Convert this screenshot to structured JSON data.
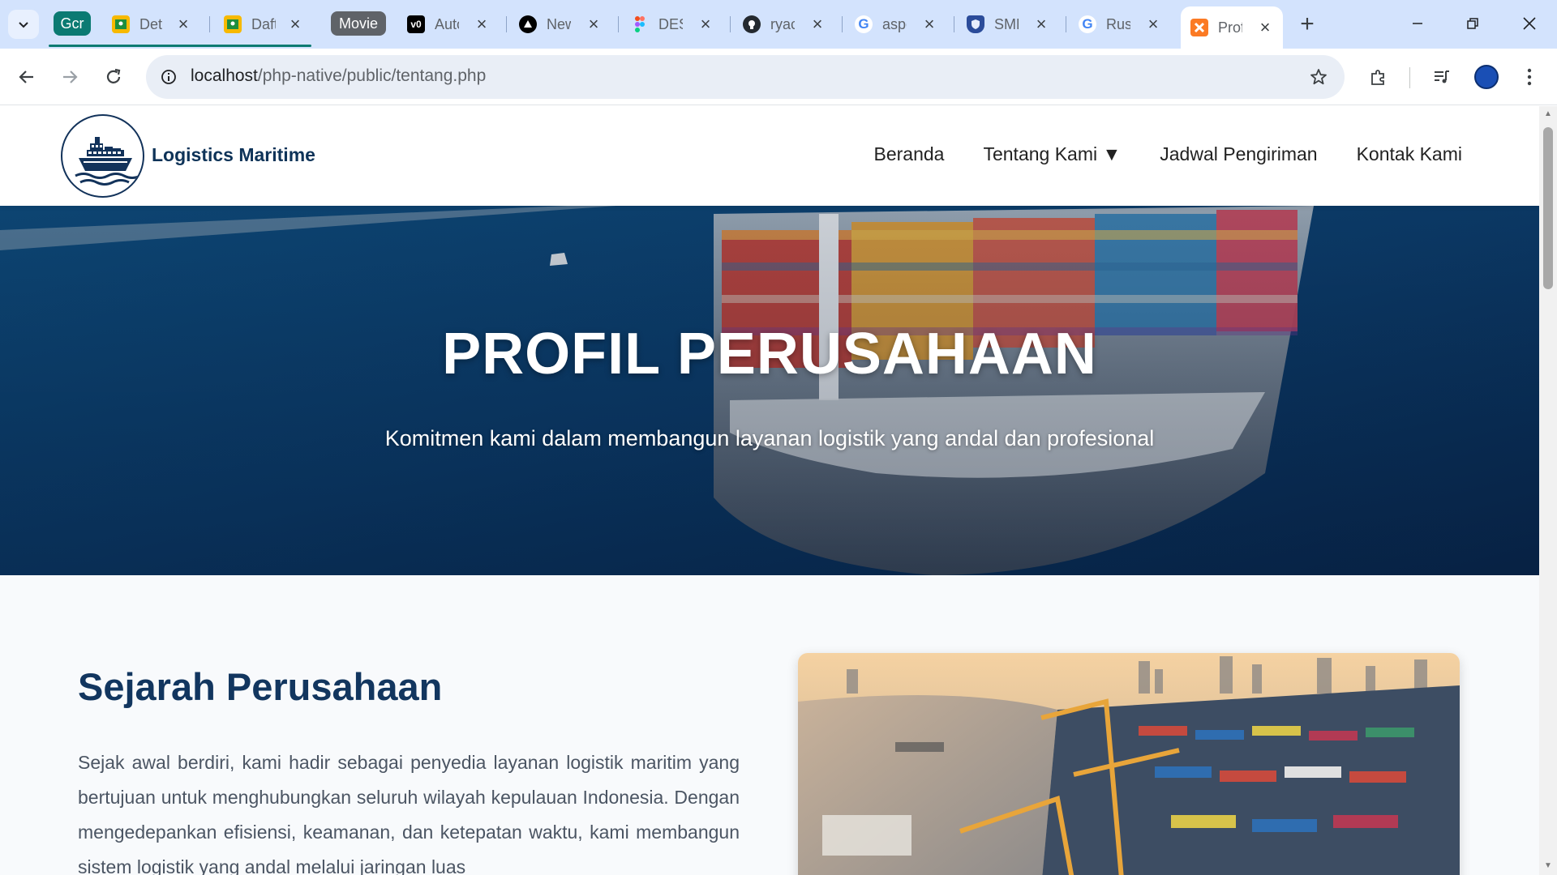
{
  "browser": {
    "groups": [
      {
        "label": "Gcr",
        "color": "#0b7a72"
      },
      {
        "label": "Movie",
        "color": "#5f6368"
      }
    ],
    "tabs": [
      {
        "label": "Det",
        "icon": "google-classroom-icon"
      },
      {
        "label": "Daft",
        "icon": "google-classroom-icon"
      },
      {
        "label": "Auto",
        "icon": "vercel-v0-icon"
      },
      {
        "label": "New",
        "icon": "nextjs-icon"
      },
      {
        "label": "DES",
        "icon": "figma-icon"
      },
      {
        "label": "ryac",
        "icon": "github-icon"
      },
      {
        "label": "aspe",
        "icon": "google-icon"
      },
      {
        "label": "SMK",
        "icon": "shield-icon"
      },
      {
        "label": "Rus",
        "icon": "google-icon"
      },
      {
        "label": "Prof",
        "icon": "xampp-icon",
        "active": true
      }
    ],
    "url_host": "localhost",
    "url_path": "/php-native/public/tentang.php"
  },
  "site": {
    "brand": "Logistics Maritime",
    "nav": [
      "Beranda",
      "Tentang Kami ▼",
      "Jadwal Pengiriman",
      "Kontak Kami"
    ],
    "hero": {
      "title": "PROFIL PERUSAHAAN",
      "subtitle": "Komitmen kami dalam membangun layanan logistik yang andal dan profesional"
    },
    "history": {
      "heading": "Sejarah Perusahaan",
      "body": "Sejak awal berdiri, kami hadir sebagai penyedia layanan logistik maritim yang bertujuan untuk menghubungkan seluruh wilayah kepulauan Indonesia. Dengan mengedepankan efisiensi, keamanan, dan ketepatan waktu, kami membangun sistem logistik yang andal melalui jaringan luas"
    }
  },
  "colors": {
    "brand_navy": "#0e3358",
    "heading_navy": "#12365f",
    "tabstrip": "#d3e3fd"
  }
}
